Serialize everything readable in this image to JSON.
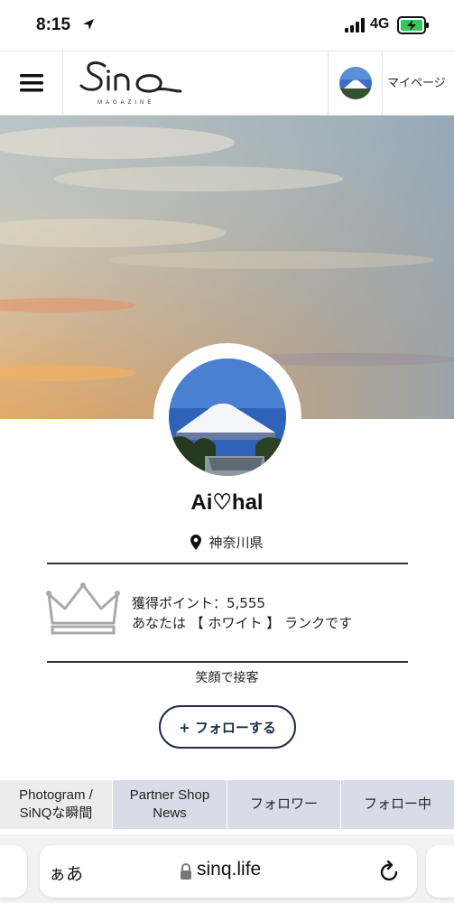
{
  "status_bar": {
    "time": "8:15",
    "network": "4G",
    "icons": [
      "location-arrow-icon",
      "signal-bars-icon",
      "battery-charging-icon"
    ]
  },
  "header": {
    "menu_icon": "hamburger-icon",
    "logo_text": "Sinq",
    "logo_subtext": "MAGAZINE",
    "mypage_label": "マイページ"
  },
  "profile": {
    "name": "Ai♡hal",
    "location": "神奈川県",
    "points_line": "獲得ポイント：5,555",
    "rank_line": "あなたは 【 ホワイト 】 ランクです",
    "bio": "笑顔で接客",
    "follow_label": "+ フォローする"
  },
  "tabs": [
    {
      "line1": "Photogram /",
      "line2": "SiNQな瞬間"
    },
    {
      "line1": "Partner Shop",
      "line2": "News"
    },
    {
      "line1": "フォロワー",
      "line2": ""
    },
    {
      "line1": "フォロー中",
      "line2": ""
    }
  ],
  "browser": {
    "text_size_label": "ぁあ",
    "domain": "sinq.life"
  },
  "colors": {
    "accent": "#1d2c48",
    "tab_inactive_bg": "#d7dce6",
    "tab_active_bg": "#ececec",
    "battery_green": "#34c759"
  }
}
